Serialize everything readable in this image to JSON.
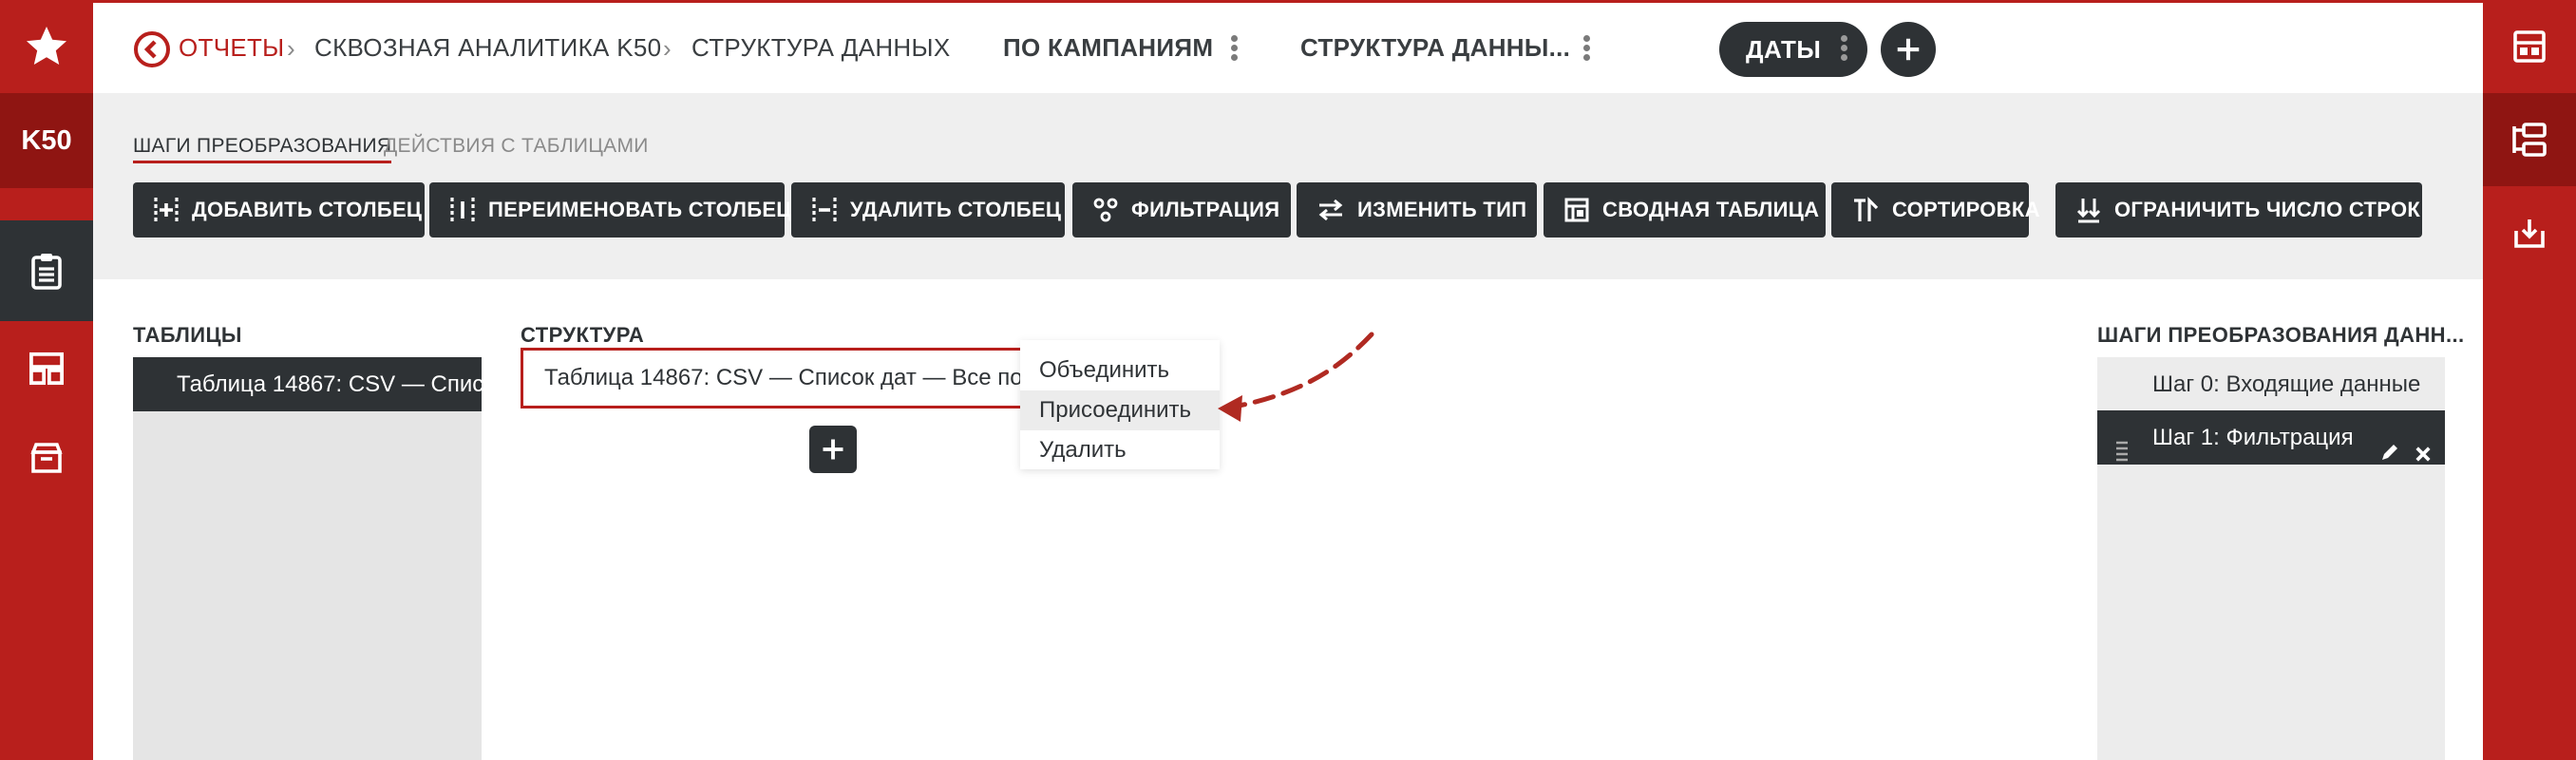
{
  "app": {
    "brand": "K50",
    "accent_color": "#b81f1c",
    "dark_color": "#2e3235"
  },
  "left_nav": {
    "icons": [
      "star-icon",
      "clipboard-icon",
      "dashboard-icon",
      "archive-icon"
    ]
  },
  "right_nav": {
    "icons": [
      "layout-icon",
      "structure-icon",
      "download-icon"
    ]
  },
  "breadcrumb": {
    "back_label": "ОТЧЕТЫ",
    "items": [
      "СКВОЗНАЯ АНАЛИТИКА K50",
      "СТРУКТУРА ДАННЫХ"
    ]
  },
  "tabs": [
    {
      "label": "ПО КАМПАНИЯМ"
    },
    {
      "label": "СТРУКТУРА ДАННЫ..."
    },
    {
      "label": "ДАТЫ",
      "active": true
    }
  ],
  "subtabs": {
    "active": "ШАГИ ПРЕОБРАЗОВАНИЯ",
    "inactive": "ДЕЙСТВИЯ С ТАБЛИЦАМИ"
  },
  "toolbar": {
    "buttons": [
      {
        "label": "ДОБАВИТЬ СТОЛБЕЦ",
        "icon": "add-column-icon"
      },
      {
        "label": "ПЕРЕИМЕНОВАТЬ СТОЛБЕЦ",
        "icon": "rename-column-icon"
      },
      {
        "label": "УДАЛИТЬ СТОЛБЕЦ",
        "icon": "delete-column-icon"
      },
      {
        "label": "ФИЛЬТРАЦИЯ",
        "icon": "filter-icon"
      },
      {
        "label": "ИЗМЕНИТЬ ТИП",
        "icon": "change-type-icon"
      },
      {
        "label": "СВОДНАЯ ТАБЛИЦА",
        "icon": "pivot-table-icon"
      },
      {
        "label": "СОРТИРОВКА",
        "icon": "sort-icon"
      },
      {
        "label": "ОГРАНИЧИТЬ ЧИСЛО СТРОК",
        "icon": "limit-rows-icon"
      }
    ]
  },
  "tables": {
    "title": "ТАБЛИЦЫ",
    "items": [
      "Таблица 14867: CSV — Спис..."
    ]
  },
  "structure": {
    "title": "СТРУКТУРА",
    "card_text": "Таблица 14867: CSV — Список дат — Все пол"
  },
  "context_menu": {
    "items": [
      "Объединить",
      "Присоединить",
      "Удалить"
    ],
    "hovered_index": 1
  },
  "steps": {
    "title": "ШАГИ ПРЕОБРАЗОВАНИЯ ДАНН...",
    "items": [
      "Шаг 0: Входящие данные",
      "Шаг 1: Фильтрация"
    ],
    "selected_index": 1
  }
}
